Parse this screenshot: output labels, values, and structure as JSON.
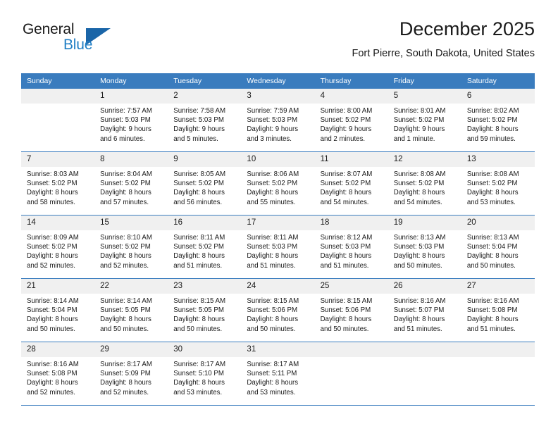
{
  "brand": {
    "line1": "General",
    "line2": "Blue",
    "triangle_icon": "triangle-icon",
    "color_dark": "#1a1a1a",
    "color_blue": "#1f7ec4",
    "color_triangle": "#1a65a8"
  },
  "header": {
    "title": "December 2025",
    "location": "Fort Pierre, South Dakota, United States"
  },
  "theme": {
    "header_row_bg": "#3a7cbe",
    "header_row_text": "#ffffff",
    "daynum_bg": "#f0f0f0",
    "grid_line": "#3a7cbe",
    "body_text": "#1a1a1a"
  },
  "weekday_headers": [
    "Sunday",
    "Monday",
    "Tuesday",
    "Wednesday",
    "Thursday",
    "Friday",
    "Saturday"
  ],
  "weeks": [
    [
      {
        "day": "",
        "sunrise": "",
        "sunset": "",
        "daylight_line1": "",
        "daylight_line2": ""
      },
      {
        "day": "1",
        "sunrise": "Sunrise: 7:57 AM",
        "sunset": "Sunset: 5:03 PM",
        "daylight_line1": "Daylight: 9 hours",
        "daylight_line2": "and 6 minutes."
      },
      {
        "day": "2",
        "sunrise": "Sunrise: 7:58 AM",
        "sunset": "Sunset: 5:03 PM",
        "daylight_line1": "Daylight: 9 hours",
        "daylight_line2": "and 5 minutes."
      },
      {
        "day": "3",
        "sunrise": "Sunrise: 7:59 AM",
        "sunset": "Sunset: 5:03 PM",
        "daylight_line1": "Daylight: 9 hours",
        "daylight_line2": "and 3 minutes."
      },
      {
        "day": "4",
        "sunrise": "Sunrise: 8:00 AM",
        "sunset": "Sunset: 5:02 PM",
        "daylight_line1": "Daylight: 9 hours",
        "daylight_line2": "and 2 minutes."
      },
      {
        "day": "5",
        "sunrise": "Sunrise: 8:01 AM",
        "sunset": "Sunset: 5:02 PM",
        "daylight_line1": "Daylight: 9 hours",
        "daylight_line2": "and 1 minute."
      },
      {
        "day": "6",
        "sunrise": "Sunrise: 8:02 AM",
        "sunset": "Sunset: 5:02 PM",
        "daylight_line1": "Daylight: 8 hours",
        "daylight_line2": "and 59 minutes."
      }
    ],
    [
      {
        "day": "7",
        "sunrise": "Sunrise: 8:03 AM",
        "sunset": "Sunset: 5:02 PM",
        "daylight_line1": "Daylight: 8 hours",
        "daylight_line2": "and 58 minutes."
      },
      {
        "day": "8",
        "sunrise": "Sunrise: 8:04 AM",
        "sunset": "Sunset: 5:02 PM",
        "daylight_line1": "Daylight: 8 hours",
        "daylight_line2": "and 57 minutes."
      },
      {
        "day": "9",
        "sunrise": "Sunrise: 8:05 AM",
        "sunset": "Sunset: 5:02 PM",
        "daylight_line1": "Daylight: 8 hours",
        "daylight_line2": "and 56 minutes."
      },
      {
        "day": "10",
        "sunrise": "Sunrise: 8:06 AM",
        "sunset": "Sunset: 5:02 PM",
        "daylight_line1": "Daylight: 8 hours",
        "daylight_line2": "and 55 minutes."
      },
      {
        "day": "11",
        "sunrise": "Sunrise: 8:07 AM",
        "sunset": "Sunset: 5:02 PM",
        "daylight_line1": "Daylight: 8 hours",
        "daylight_line2": "and 54 minutes."
      },
      {
        "day": "12",
        "sunrise": "Sunrise: 8:08 AM",
        "sunset": "Sunset: 5:02 PM",
        "daylight_line1": "Daylight: 8 hours",
        "daylight_line2": "and 54 minutes."
      },
      {
        "day": "13",
        "sunrise": "Sunrise: 8:08 AM",
        "sunset": "Sunset: 5:02 PM",
        "daylight_line1": "Daylight: 8 hours",
        "daylight_line2": "and 53 minutes."
      }
    ],
    [
      {
        "day": "14",
        "sunrise": "Sunrise: 8:09 AM",
        "sunset": "Sunset: 5:02 PM",
        "daylight_line1": "Daylight: 8 hours",
        "daylight_line2": "and 52 minutes."
      },
      {
        "day": "15",
        "sunrise": "Sunrise: 8:10 AM",
        "sunset": "Sunset: 5:02 PM",
        "daylight_line1": "Daylight: 8 hours",
        "daylight_line2": "and 52 minutes."
      },
      {
        "day": "16",
        "sunrise": "Sunrise: 8:11 AM",
        "sunset": "Sunset: 5:02 PM",
        "daylight_line1": "Daylight: 8 hours",
        "daylight_line2": "and 51 minutes."
      },
      {
        "day": "17",
        "sunrise": "Sunrise: 8:11 AM",
        "sunset": "Sunset: 5:03 PM",
        "daylight_line1": "Daylight: 8 hours",
        "daylight_line2": "and 51 minutes."
      },
      {
        "day": "18",
        "sunrise": "Sunrise: 8:12 AM",
        "sunset": "Sunset: 5:03 PM",
        "daylight_line1": "Daylight: 8 hours",
        "daylight_line2": "and 51 minutes."
      },
      {
        "day": "19",
        "sunrise": "Sunrise: 8:13 AM",
        "sunset": "Sunset: 5:03 PM",
        "daylight_line1": "Daylight: 8 hours",
        "daylight_line2": "and 50 minutes."
      },
      {
        "day": "20",
        "sunrise": "Sunrise: 8:13 AM",
        "sunset": "Sunset: 5:04 PM",
        "daylight_line1": "Daylight: 8 hours",
        "daylight_line2": "and 50 minutes."
      }
    ],
    [
      {
        "day": "21",
        "sunrise": "Sunrise: 8:14 AM",
        "sunset": "Sunset: 5:04 PM",
        "daylight_line1": "Daylight: 8 hours",
        "daylight_line2": "and 50 minutes."
      },
      {
        "day": "22",
        "sunrise": "Sunrise: 8:14 AM",
        "sunset": "Sunset: 5:05 PM",
        "daylight_line1": "Daylight: 8 hours",
        "daylight_line2": "and 50 minutes."
      },
      {
        "day": "23",
        "sunrise": "Sunrise: 8:15 AM",
        "sunset": "Sunset: 5:05 PM",
        "daylight_line1": "Daylight: 8 hours",
        "daylight_line2": "and 50 minutes."
      },
      {
        "day": "24",
        "sunrise": "Sunrise: 8:15 AM",
        "sunset": "Sunset: 5:06 PM",
        "daylight_line1": "Daylight: 8 hours",
        "daylight_line2": "and 50 minutes."
      },
      {
        "day": "25",
        "sunrise": "Sunrise: 8:15 AM",
        "sunset": "Sunset: 5:06 PM",
        "daylight_line1": "Daylight: 8 hours",
        "daylight_line2": "and 50 minutes."
      },
      {
        "day": "26",
        "sunrise": "Sunrise: 8:16 AM",
        "sunset": "Sunset: 5:07 PM",
        "daylight_line1": "Daylight: 8 hours",
        "daylight_line2": "and 51 minutes."
      },
      {
        "day": "27",
        "sunrise": "Sunrise: 8:16 AM",
        "sunset": "Sunset: 5:08 PM",
        "daylight_line1": "Daylight: 8 hours",
        "daylight_line2": "and 51 minutes."
      }
    ],
    [
      {
        "day": "28",
        "sunrise": "Sunrise: 8:16 AM",
        "sunset": "Sunset: 5:08 PM",
        "daylight_line1": "Daylight: 8 hours",
        "daylight_line2": "and 52 minutes."
      },
      {
        "day": "29",
        "sunrise": "Sunrise: 8:17 AM",
        "sunset": "Sunset: 5:09 PM",
        "daylight_line1": "Daylight: 8 hours",
        "daylight_line2": "and 52 minutes."
      },
      {
        "day": "30",
        "sunrise": "Sunrise: 8:17 AM",
        "sunset": "Sunset: 5:10 PM",
        "daylight_line1": "Daylight: 8 hours",
        "daylight_line2": "and 53 minutes."
      },
      {
        "day": "31",
        "sunrise": "Sunrise: 8:17 AM",
        "sunset": "Sunset: 5:11 PM",
        "daylight_line1": "Daylight: 8 hours",
        "daylight_line2": "and 53 minutes."
      },
      {
        "day": "",
        "sunrise": "",
        "sunset": "",
        "daylight_line1": "",
        "daylight_line2": ""
      },
      {
        "day": "",
        "sunrise": "",
        "sunset": "",
        "daylight_line1": "",
        "daylight_line2": ""
      },
      {
        "day": "",
        "sunrise": "",
        "sunset": "",
        "daylight_line1": "",
        "daylight_line2": ""
      }
    ]
  ]
}
